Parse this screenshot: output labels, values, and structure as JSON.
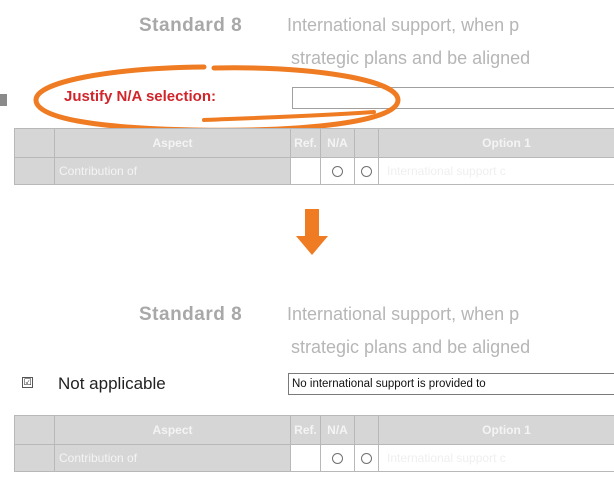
{
  "top": {
    "standard_label": "Standard 8",
    "standard_text_line1": "International support, when p",
    "standard_text_line2": "strategic plans and be aligned",
    "justify_label": "Justify N/A selection:",
    "justify_value": ""
  },
  "table": {
    "headers": [
      "Aspect",
      "Ref.",
      "N/A",
      "",
      "Option 1"
    ],
    "row": {
      "aspect": "Contribution of",
      "ref": "",
      "option_text": "International support c"
    }
  },
  "bottom": {
    "standard_label": "Standard 8",
    "standard_text_line1": "International support, when p",
    "standard_text_line2": "strategic plans and be aligned",
    "na_checked": "☑",
    "na_label": "Not applicable",
    "justify_value": "No international support is provided to",
    "table_row_option_text": "International support c"
  },
  "colors": {
    "accent": "#ef7b22",
    "justify_label": "#d0262b",
    "header_grey": "#d6d6d6"
  },
  "icons": [
    "down-arrow-icon",
    "checkbox-checked-icon",
    "radio-icon",
    "highlight-ellipse"
  ]
}
